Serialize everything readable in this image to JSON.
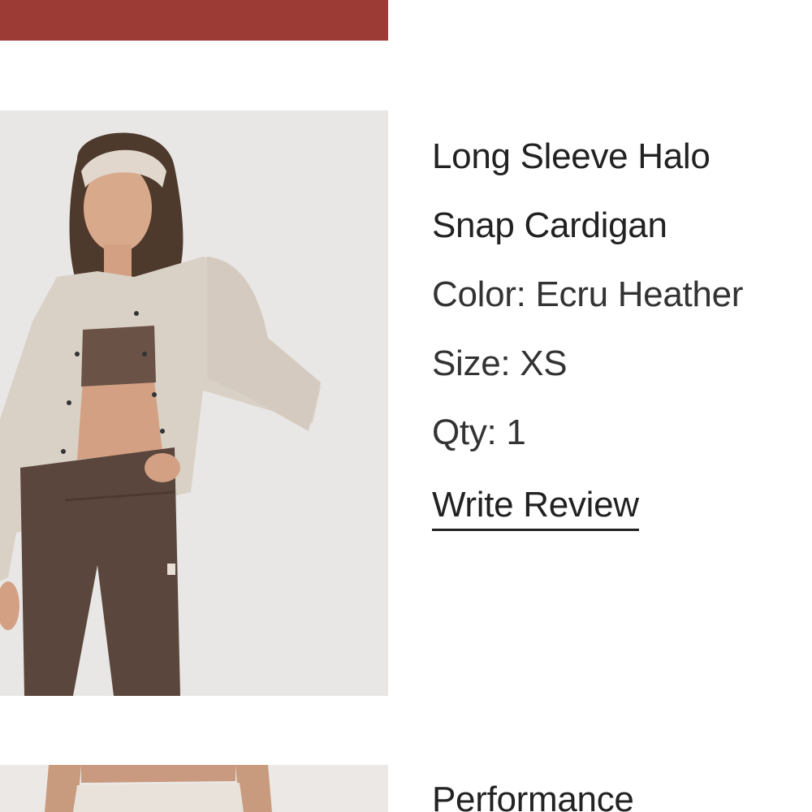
{
  "previous_item": {
    "image_color": "#9c3a36"
  },
  "item": {
    "title": "Long Sleeve Halo Snap Cardigan",
    "color_line": "Color: Ecru Heather",
    "size_line": "Size: XS",
    "qty_line": "Qty: 1",
    "write_review_label": "Write Review",
    "image_alt": "Model wearing ecru snap cardigan, brown bra top and brown leggings"
  },
  "next_item": {
    "title": "Performance"
  },
  "colors": {
    "background": "#ffffff",
    "text": "#222222",
    "photo_background": "#e9e7e5",
    "cardigan": "#d9d0c6",
    "leggings": "#5a463d"
  }
}
